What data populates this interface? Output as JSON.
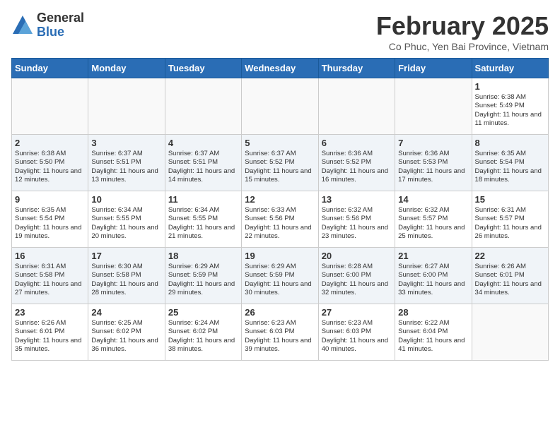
{
  "logo": {
    "general": "General",
    "blue": "Blue"
  },
  "title": "February 2025",
  "subtitle": "Co Phuc, Yen Bai Province, Vietnam",
  "weekdays": [
    "Sunday",
    "Monday",
    "Tuesday",
    "Wednesday",
    "Thursday",
    "Friday",
    "Saturday"
  ],
  "weeks": [
    [
      {
        "day": "",
        "info": ""
      },
      {
        "day": "",
        "info": ""
      },
      {
        "day": "",
        "info": ""
      },
      {
        "day": "",
        "info": ""
      },
      {
        "day": "",
        "info": ""
      },
      {
        "day": "",
        "info": ""
      },
      {
        "day": "1",
        "info": "Sunrise: 6:38 AM\nSunset: 5:49 PM\nDaylight: 11 hours and 11 minutes."
      }
    ],
    [
      {
        "day": "2",
        "info": "Sunrise: 6:38 AM\nSunset: 5:50 PM\nDaylight: 11 hours and 12 minutes."
      },
      {
        "day": "3",
        "info": "Sunrise: 6:37 AM\nSunset: 5:51 PM\nDaylight: 11 hours and 13 minutes."
      },
      {
        "day": "4",
        "info": "Sunrise: 6:37 AM\nSunset: 5:51 PM\nDaylight: 11 hours and 14 minutes."
      },
      {
        "day": "5",
        "info": "Sunrise: 6:37 AM\nSunset: 5:52 PM\nDaylight: 11 hours and 15 minutes."
      },
      {
        "day": "6",
        "info": "Sunrise: 6:36 AM\nSunset: 5:52 PM\nDaylight: 11 hours and 16 minutes."
      },
      {
        "day": "7",
        "info": "Sunrise: 6:36 AM\nSunset: 5:53 PM\nDaylight: 11 hours and 17 minutes."
      },
      {
        "day": "8",
        "info": "Sunrise: 6:35 AM\nSunset: 5:54 PM\nDaylight: 11 hours and 18 minutes."
      }
    ],
    [
      {
        "day": "9",
        "info": "Sunrise: 6:35 AM\nSunset: 5:54 PM\nDaylight: 11 hours and 19 minutes."
      },
      {
        "day": "10",
        "info": "Sunrise: 6:34 AM\nSunset: 5:55 PM\nDaylight: 11 hours and 20 minutes."
      },
      {
        "day": "11",
        "info": "Sunrise: 6:34 AM\nSunset: 5:55 PM\nDaylight: 11 hours and 21 minutes."
      },
      {
        "day": "12",
        "info": "Sunrise: 6:33 AM\nSunset: 5:56 PM\nDaylight: 11 hours and 22 minutes."
      },
      {
        "day": "13",
        "info": "Sunrise: 6:32 AM\nSunset: 5:56 PM\nDaylight: 11 hours and 23 minutes."
      },
      {
        "day": "14",
        "info": "Sunrise: 6:32 AM\nSunset: 5:57 PM\nDaylight: 11 hours and 25 minutes."
      },
      {
        "day": "15",
        "info": "Sunrise: 6:31 AM\nSunset: 5:57 PM\nDaylight: 11 hours and 26 minutes."
      }
    ],
    [
      {
        "day": "16",
        "info": "Sunrise: 6:31 AM\nSunset: 5:58 PM\nDaylight: 11 hours and 27 minutes."
      },
      {
        "day": "17",
        "info": "Sunrise: 6:30 AM\nSunset: 5:58 PM\nDaylight: 11 hours and 28 minutes."
      },
      {
        "day": "18",
        "info": "Sunrise: 6:29 AM\nSunset: 5:59 PM\nDaylight: 11 hours and 29 minutes."
      },
      {
        "day": "19",
        "info": "Sunrise: 6:29 AM\nSunset: 5:59 PM\nDaylight: 11 hours and 30 minutes."
      },
      {
        "day": "20",
        "info": "Sunrise: 6:28 AM\nSunset: 6:00 PM\nDaylight: 11 hours and 32 minutes."
      },
      {
        "day": "21",
        "info": "Sunrise: 6:27 AM\nSunset: 6:00 PM\nDaylight: 11 hours and 33 minutes."
      },
      {
        "day": "22",
        "info": "Sunrise: 6:26 AM\nSunset: 6:01 PM\nDaylight: 11 hours and 34 minutes."
      }
    ],
    [
      {
        "day": "23",
        "info": "Sunrise: 6:26 AM\nSunset: 6:01 PM\nDaylight: 11 hours and 35 minutes."
      },
      {
        "day": "24",
        "info": "Sunrise: 6:25 AM\nSunset: 6:02 PM\nDaylight: 11 hours and 36 minutes."
      },
      {
        "day": "25",
        "info": "Sunrise: 6:24 AM\nSunset: 6:02 PM\nDaylight: 11 hours and 38 minutes."
      },
      {
        "day": "26",
        "info": "Sunrise: 6:23 AM\nSunset: 6:03 PM\nDaylight: 11 hours and 39 minutes."
      },
      {
        "day": "27",
        "info": "Sunrise: 6:23 AM\nSunset: 6:03 PM\nDaylight: 11 hours and 40 minutes."
      },
      {
        "day": "28",
        "info": "Sunrise: 6:22 AM\nSunset: 6:04 PM\nDaylight: 11 hours and 41 minutes."
      },
      {
        "day": "",
        "info": ""
      }
    ]
  ]
}
